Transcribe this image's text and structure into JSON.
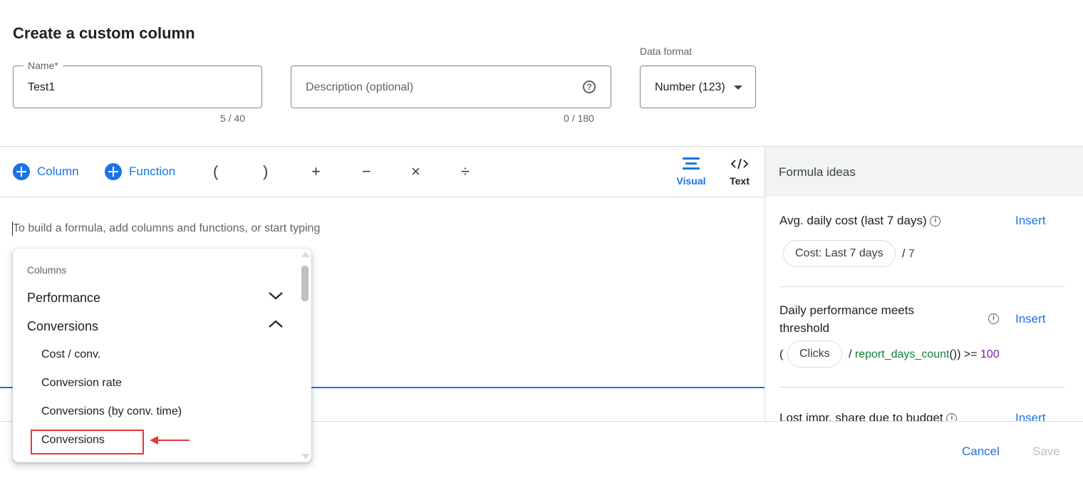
{
  "page": {
    "title": "Create a custom column"
  },
  "name_field": {
    "label": "Name*",
    "value": "Test1",
    "counter": "5 / 40"
  },
  "description_field": {
    "placeholder": "Description (optional)",
    "counter": "0 / 180",
    "help_icon": "?"
  },
  "data_format": {
    "label": "Data format",
    "selected": "Number (123)"
  },
  "toolbar": {
    "column_label": "Column",
    "function_label": "Function",
    "operators": [
      "(",
      ")",
      "+",
      "−",
      "×",
      "÷"
    ],
    "visual_label": "Visual",
    "text_label": "Text"
  },
  "editor": {
    "placeholder": "To build a formula, add columns and functions, or start typing"
  },
  "formula_ideas": {
    "title": "Formula ideas",
    "items": [
      {
        "title": "Avg. daily cost (last 7 days)",
        "insert_label": "Insert",
        "chip": "Cost: Last 7 days",
        "suffix_op": "/",
        "suffix_num": "7"
      },
      {
        "title": "Daily performance meets threshold",
        "insert_label": "Insert",
        "open_paren": "(",
        "chip": "Clicks",
        "slash": "/",
        "fn": "report_days_count",
        "fn_close": "())",
        "compare": ">=",
        "num": "100"
      },
      {
        "title": "Lost impr. share due to budget",
        "insert_label": "Insert"
      }
    ]
  },
  "footer": {
    "cancel_label": "Cancel",
    "save_label": "Save"
  },
  "dropdown": {
    "header": "Columns",
    "categories": [
      {
        "label": "Performance",
        "expanded": false
      },
      {
        "label": "Conversions",
        "expanded": true
      }
    ],
    "items": [
      "Cost / conv.",
      "Conversion rate",
      "Conversions (by conv. time)",
      "Conversions"
    ]
  },
  "colors": {
    "accent": "#1a73e8",
    "annotation": "#e53935",
    "function_text": "#188038",
    "number_text": "#7b1fa2"
  }
}
